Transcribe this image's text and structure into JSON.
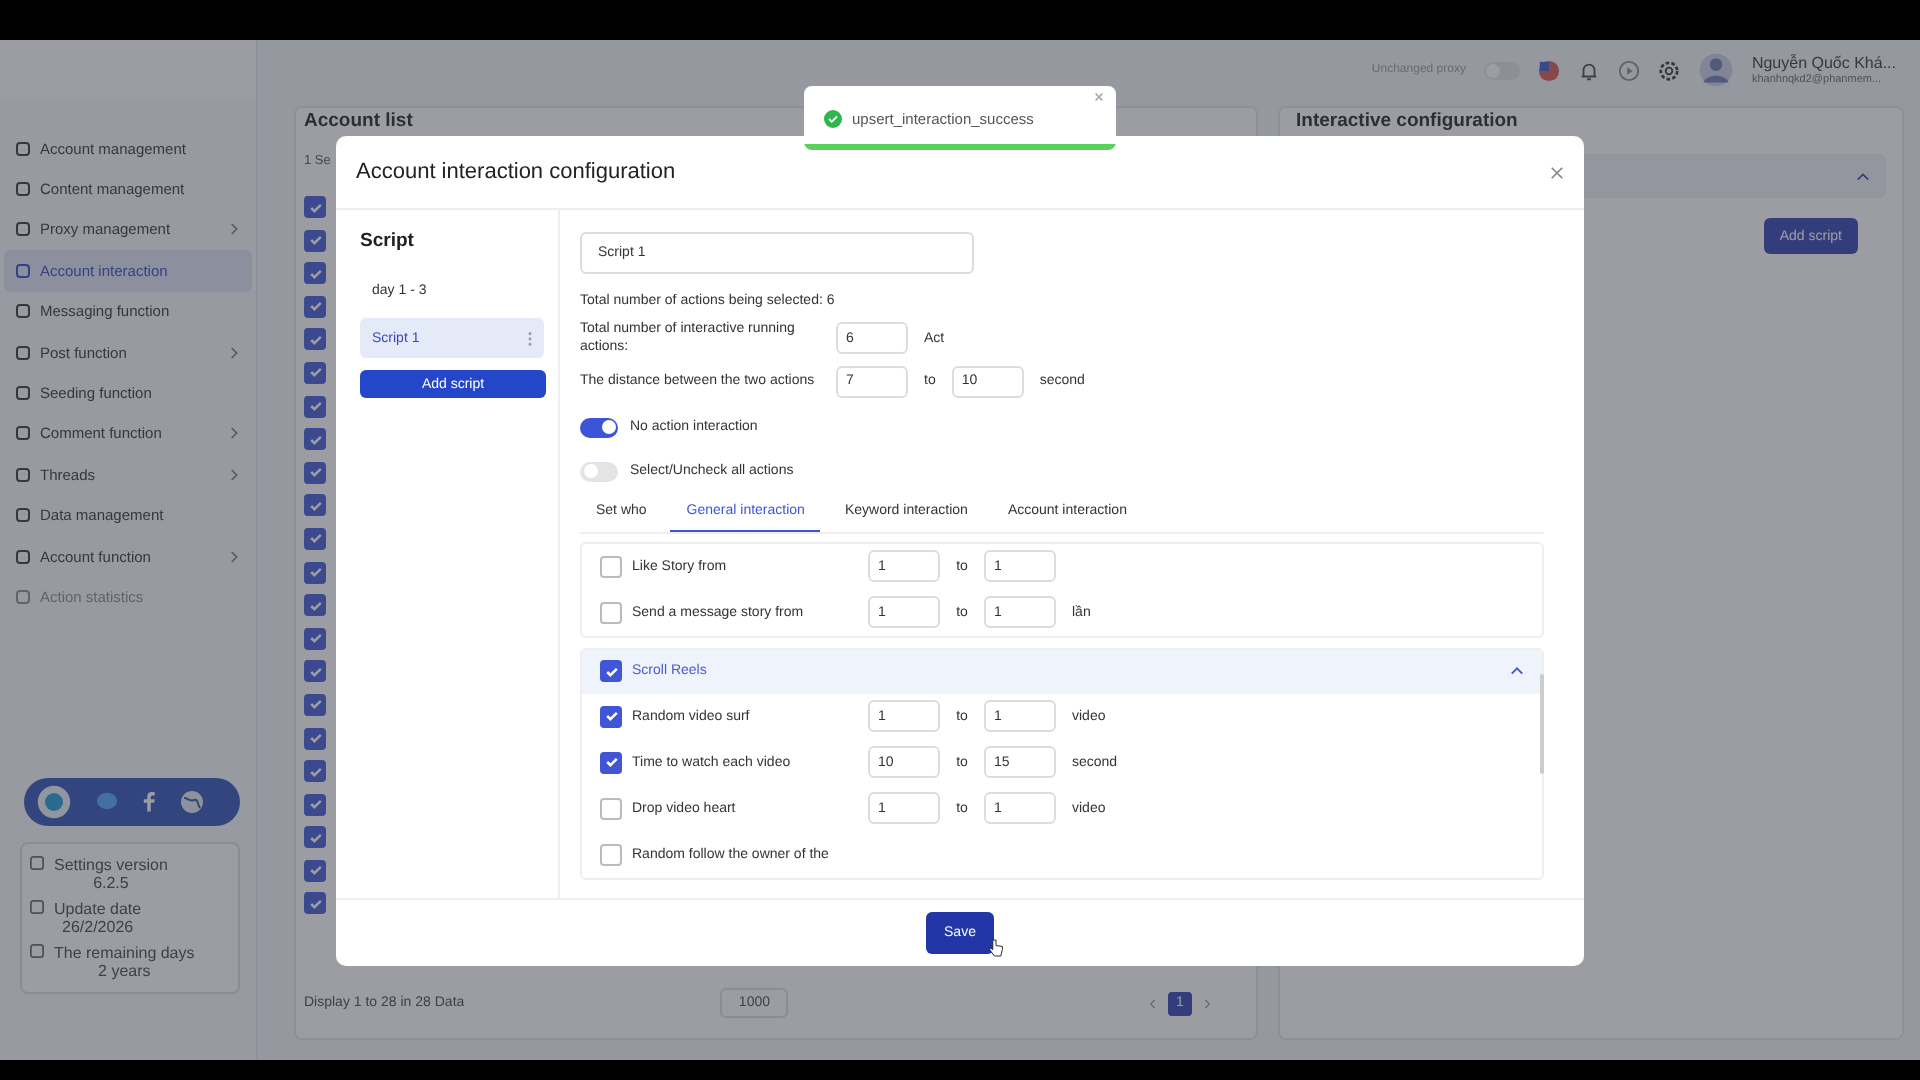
{
  "sidebar": {
    "items": [
      {
        "label": "Account management",
        "selected": false,
        "expandable": false,
        "disabled": false
      },
      {
        "label": "Content management",
        "selected": false,
        "expandable": false,
        "disabled": false
      },
      {
        "label": "Proxy management",
        "selected": false,
        "expandable": true,
        "disabled": false
      },
      {
        "label": "Account interaction",
        "selected": true,
        "expandable": false,
        "disabled": false
      },
      {
        "label": "Messaging function",
        "selected": false,
        "expandable": false,
        "disabled": false
      },
      {
        "label": "Post function",
        "selected": false,
        "expandable": true,
        "disabled": false
      },
      {
        "label": "Seeding function",
        "selected": false,
        "expandable": false,
        "disabled": false
      },
      {
        "label": "Comment function",
        "selected": false,
        "expandable": true,
        "disabled": false
      },
      {
        "label": "Threads",
        "selected": false,
        "expandable": true,
        "disabled": false
      },
      {
        "label": "Data management",
        "selected": false,
        "expandable": false,
        "disabled": false
      },
      {
        "label": "Account function",
        "selected": false,
        "expandable": true,
        "disabled": false
      },
      {
        "label": "Action statistics",
        "selected": false,
        "expandable": false,
        "disabled": true
      }
    ],
    "info": [
      {
        "label": "Settings version",
        "value": "6.2.5"
      },
      {
        "label": "Update date",
        "value": "26/2/2026"
      },
      {
        "label": "The remaining days",
        "value": "2 years"
      }
    ]
  },
  "header": {
    "proxy_label": "Unchanged proxy",
    "proxy_on": false,
    "user_name": "Nguyễn Quốc Khá...",
    "user_email": "khanhnqkd2@phanmem..."
  },
  "account_list": {
    "title": "Account list",
    "selected_text": "1 Se",
    "rows": [
      {
        "checked": true
      },
      {
        "checked": true
      },
      {
        "checked": true
      },
      {
        "checked": true
      },
      {
        "checked": true
      },
      {
        "checked": true
      },
      {
        "checked": true
      },
      {
        "checked": true
      },
      {
        "checked": true
      },
      {
        "checked": true
      },
      {
        "checked": true
      },
      {
        "checked": true
      },
      {
        "checked": true
      },
      {
        "checked": true
      },
      {
        "checked": true
      },
      {
        "checked": true
      },
      {
        "checked": true
      },
      {
        "checked": true
      },
      {
        "checked": true
      },
      {
        "checked": true
      },
      {
        "checked": true
      },
      {
        "checked": true
      }
    ],
    "footer_text": "Display 1 to 28 in 28 Data",
    "page_size": "1000",
    "pages": [
      {
        "label": "1",
        "selected": true
      }
    ]
  },
  "config_panel": {
    "title": "Interactive configuration",
    "add_button": "Add script"
  },
  "toast": {
    "message": "upsert_interaction_success",
    "level": 1
  },
  "modal": {
    "title": "Account interaction configuration",
    "script_heading": "Script",
    "scripts": [
      {
        "label": "day 1 - 3",
        "selected": false
      },
      {
        "label": "Script 1",
        "selected": true
      }
    ],
    "add_button": "Add script",
    "name_value": "Script 1",
    "total_selected": "Total number of actions being selected: 6",
    "running": {
      "label": "Total number of interactive running actions:",
      "value": "6",
      "unit": "Act"
    },
    "distance": {
      "label": "The distance between the two actions",
      "from": "7",
      "to_label": "to",
      "to": "10",
      "unit": "second"
    },
    "toggles": [
      {
        "label": "No action interaction",
        "on": true
      },
      {
        "label": "Select/Uncheck all actions",
        "on": false
      }
    ],
    "tabs": [
      {
        "label": "Set who",
        "selected": false
      },
      {
        "label": "General interaction",
        "selected": true
      },
      {
        "label": "Keyword interaction",
        "selected": false
      },
      {
        "label": "Account interaction",
        "selected": false
      }
    ],
    "groups": [
      {
        "kind": "plain",
        "actions": [
          {
            "label": "Like Story from",
            "checked": false,
            "from": "1",
            "to_label": "to",
            "to": "1"
          },
          {
            "label": "Send a message story from",
            "checked": false,
            "from": "1",
            "to_label": "to",
            "to": "1",
            "unit": "lần"
          }
        ]
      },
      {
        "kind": "section",
        "title": "Scroll Reels",
        "checked": true,
        "expanded": true,
        "actions": [
          {
            "label": "Random video surf",
            "checked": true,
            "from": "1",
            "to_label": "to",
            "to": "1",
            "unit": "video"
          },
          {
            "label": "Time to watch each video",
            "checked": true,
            "from": "10",
            "to_label": "to",
            "to": "15",
            "unit": "second"
          },
          {
            "label": "Drop video heart",
            "checked": false,
            "from": "1",
            "to_label": "to",
            "to": "1",
            "unit": "video"
          },
          {
            "label": "Random follow the owner of the",
            "checked": false
          }
        ]
      }
    ],
    "save_button": "Save"
  }
}
